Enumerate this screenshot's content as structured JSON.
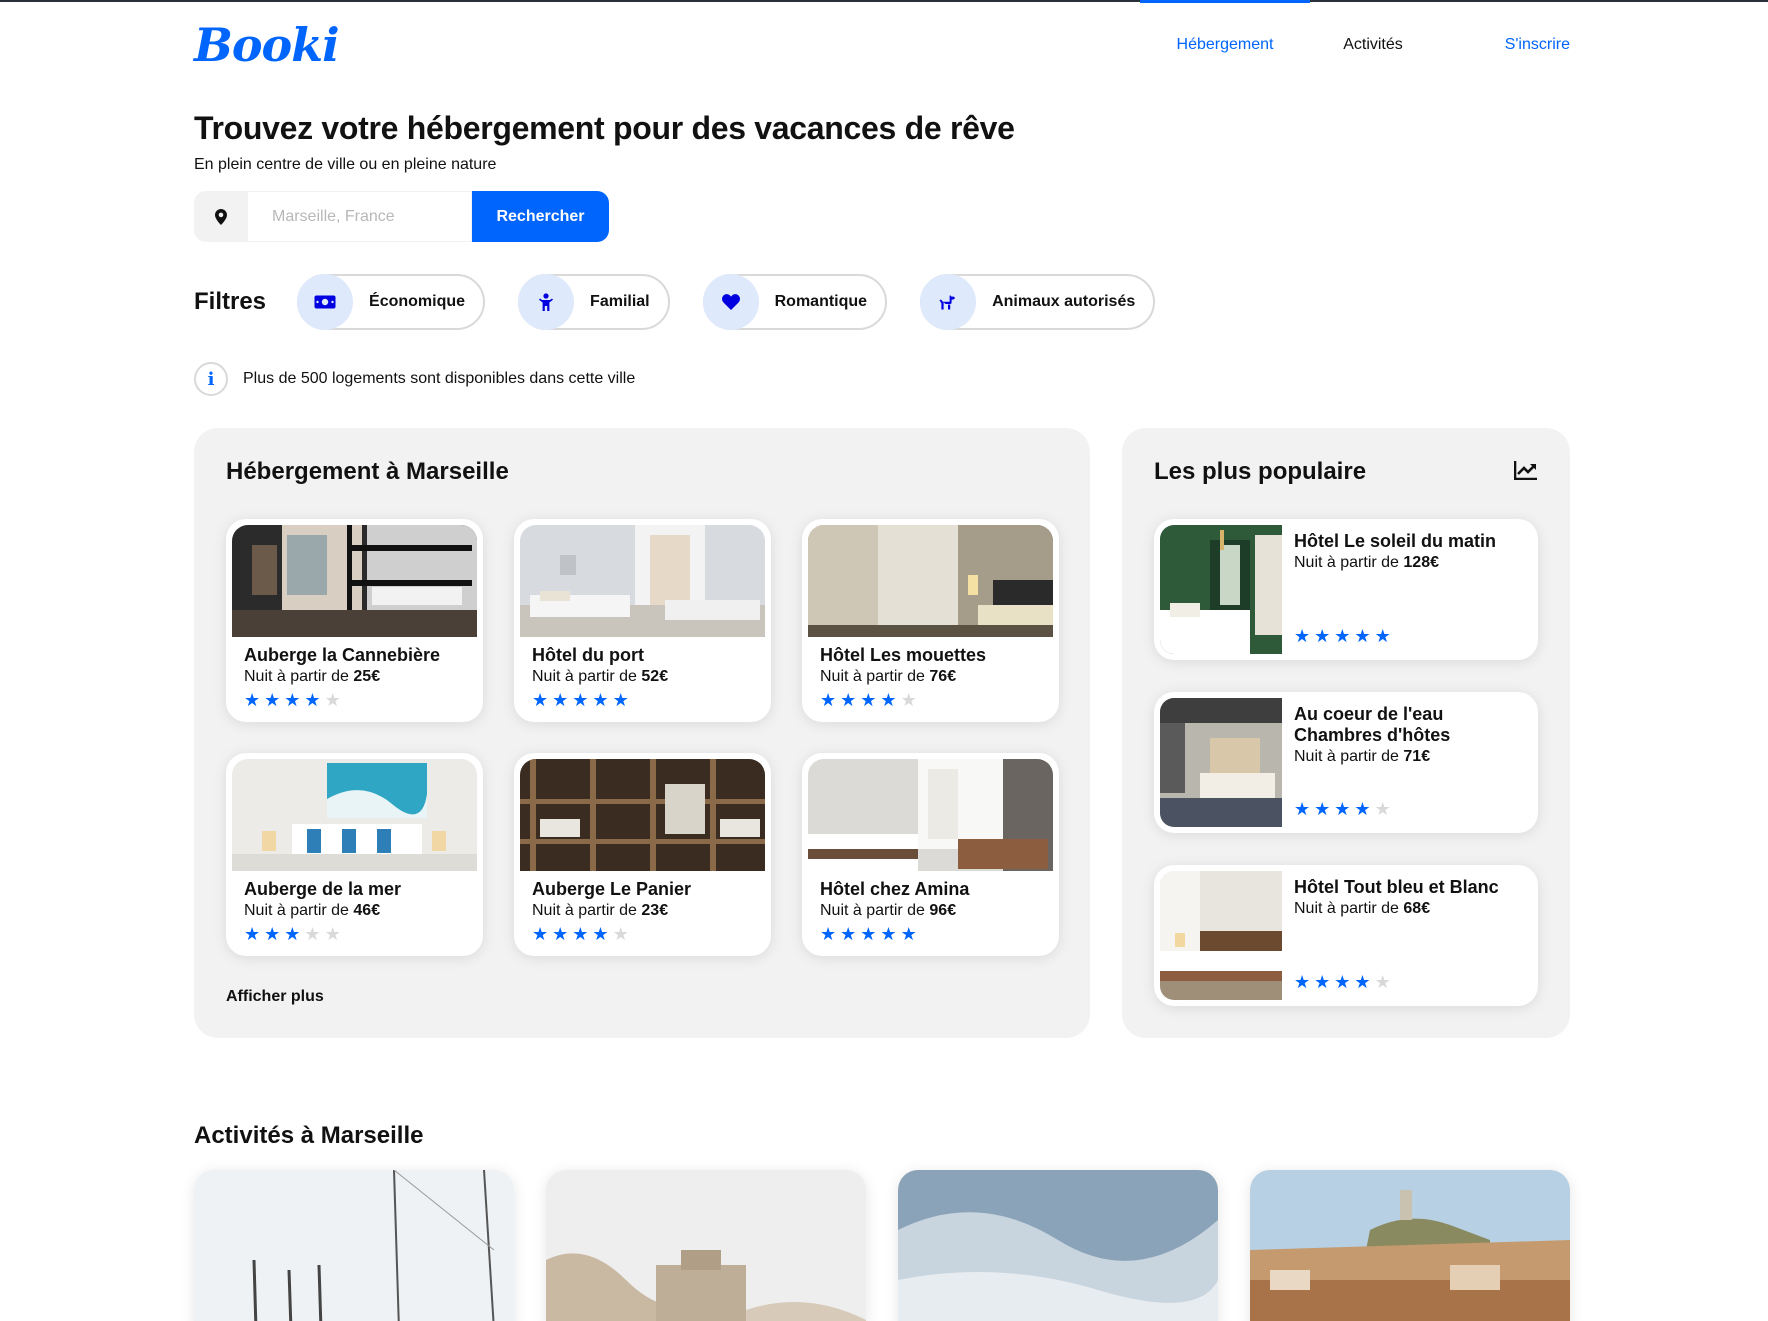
{
  "header": {
    "logo": "Booki",
    "nav": [
      {
        "label": "Hébergement",
        "active": true
      },
      {
        "label": "Activités",
        "active": false
      },
      {
        "label": "S'inscrire",
        "active": false
      }
    ]
  },
  "hero": {
    "title": "Trouvez votre hébergement pour des vacances de rêve",
    "subtitle": "En plein centre de ville ou en pleine nature"
  },
  "search": {
    "icon": "location-pin-icon",
    "placeholder": "Marseille, France",
    "button_label": "Rechercher"
  },
  "filters": {
    "label": "Filtres",
    "items": [
      {
        "label": "Économique",
        "icon": "money-bill-icon"
      },
      {
        "label": "Familial",
        "icon": "child-icon"
      },
      {
        "label": "Romantique",
        "icon": "heart-icon"
      },
      {
        "label": "Animaux autorisés",
        "icon": "dog-icon"
      }
    ]
  },
  "info": {
    "icon": "info-icon",
    "text": "Plus de 500 logements sont disponibles dans cette ville"
  },
  "accommodations": {
    "title": "Hébergement à Marseille",
    "price_prefix": "Nuit à partir de",
    "items": [
      {
        "name": "Auberge la Cannebière",
        "price": "25€",
        "rating": 4
      },
      {
        "name": "Hôtel du port",
        "price": "52€",
        "rating": 5
      },
      {
        "name": "Hôtel Les mouettes",
        "price": "76€",
        "rating": 4
      },
      {
        "name": "Auberge de la mer",
        "price": "46€",
        "rating": 3
      },
      {
        "name": "Auberge Le Panier",
        "price": "23€",
        "rating": 4
      },
      {
        "name": "Hôtel chez Amina",
        "price": "96€",
        "rating": 5
      }
    ],
    "more_label": "Afficher plus"
  },
  "popular": {
    "title": "Les plus populaire",
    "icon": "chart-line-icon",
    "price_prefix": "Nuit à partir de",
    "items": [
      {
        "name": "Hôtel Le soleil du matin",
        "price": "128€",
        "rating": 5
      },
      {
        "name": "Au coeur de l'eau Chambres d'hôtes",
        "price": "71€",
        "rating": 4
      },
      {
        "name": "Hôtel Tout bleu et Blanc",
        "price": "68€",
        "rating": 4
      }
    ]
  },
  "activities": {
    "title": "Activités à Marseille"
  },
  "colors": {
    "accent": "#0065fc",
    "chip_bg": "#dee9fc",
    "panel_bg": "#f2f2f2",
    "star_off": "#d9d9d9"
  }
}
